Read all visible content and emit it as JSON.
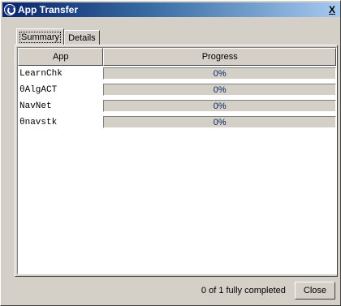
{
  "window": {
    "title": "App Transfer"
  },
  "tabs": [
    {
      "label": "Summary"
    },
    {
      "label": "Details"
    }
  ],
  "table": {
    "columns": [
      "App",
      "Progress"
    ],
    "rows": [
      {
        "app": "LearnChk",
        "progress_text": "0%",
        "progress": 0
      },
      {
        "app": "θAlgACT",
        "progress_text": "0%",
        "progress": 0
      },
      {
        "app": "NavNet",
        "progress_text": "0%",
        "progress": 0
      },
      {
        "app": "θnavstk",
        "progress_text": "0%",
        "progress": 0
      }
    ]
  },
  "footer": {
    "status": "0 of 1 fully completed",
    "close_label": "Close"
  },
  "colors": {
    "title_bar_start": "#0a246a",
    "title_bar_end": "#a6caf0",
    "window_face": "#d4d0c8",
    "progress_text": "#0a246a"
  }
}
